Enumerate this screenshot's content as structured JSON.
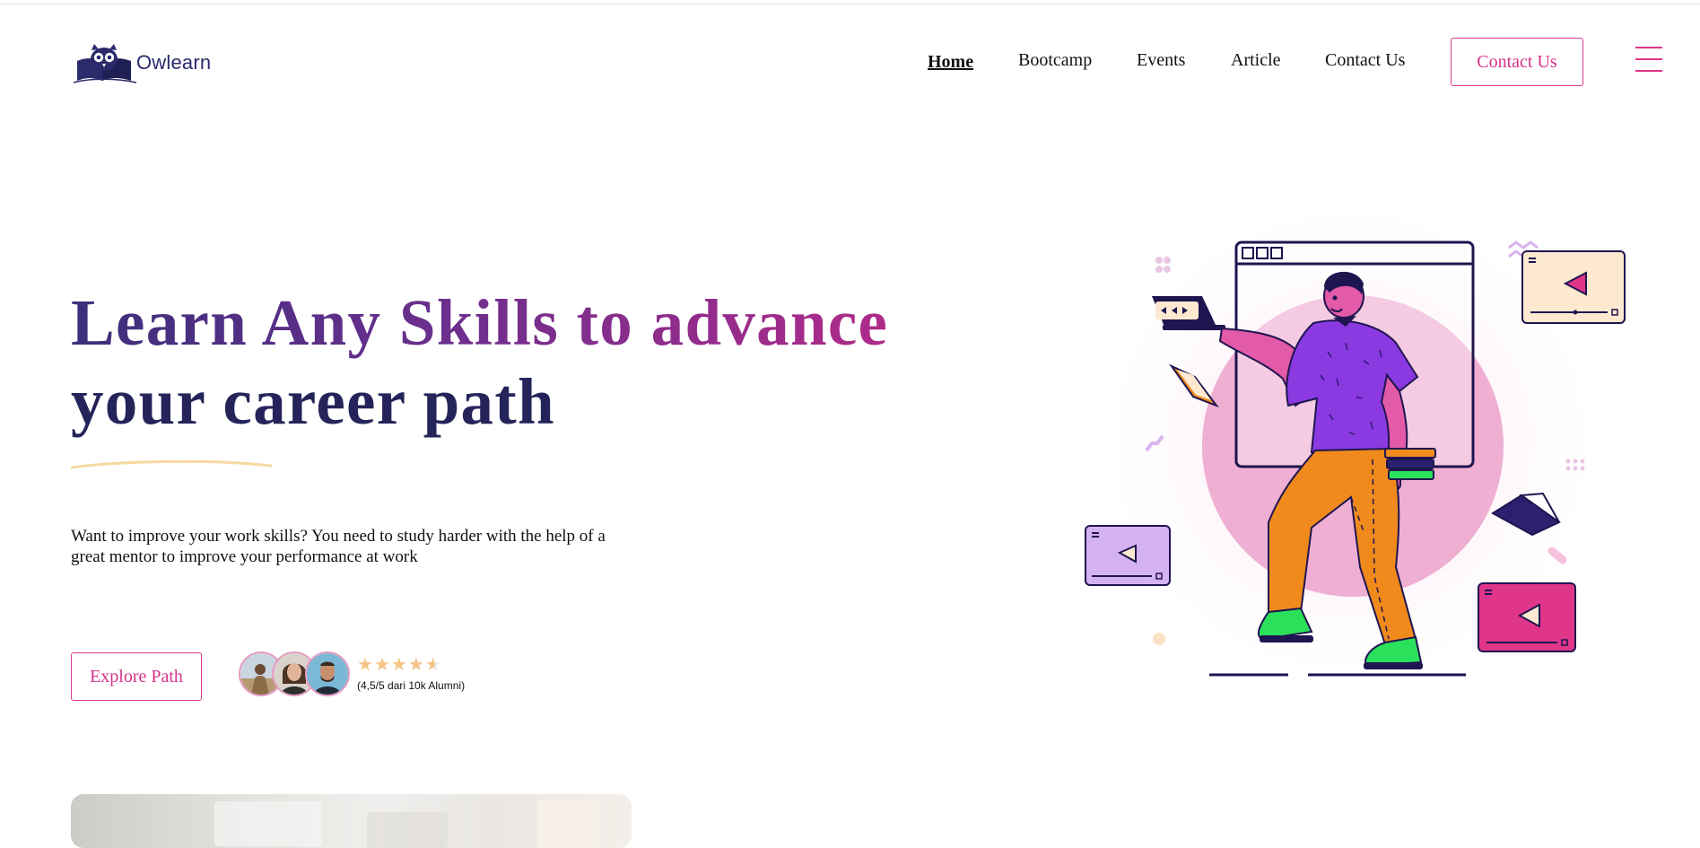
{
  "brand": {
    "name": "Owlearn"
  },
  "nav": {
    "items": [
      {
        "label": "Home",
        "active": true
      },
      {
        "label": "Bootcamp",
        "active": false
      },
      {
        "label": "Events",
        "active": false
      },
      {
        "label": "Article",
        "active": false
      },
      {
        "label": "Contact Us",
        "active": false
      }
    ],
    "cta_label": "Contact Us",
    "menu_icon": "hamburger-menu-icon"
  },
  "hero": {
    "title_line1": "Learn Any Skills to advance",
    "title_line2": "your career path",
    "description": "Want to improve your work skills? You need to study harder with the help of a great mentor to improve your performance at work",
    "explore_label": "Explore Path",
    "rating": {
      "score": 4.5,
      "max": 5,
      "text": "(4,5/5 dari 10k Alumni)"
    },
    "alumni_avatars": 3
  },
  "colors": {
    "accent_pink": "#d6338a",
    "title_navy": "#25245a",
    "title_gradient_start": "#3c2f7a",
    "title_gradient_end": "#b02b8a",
    "underline_gold": "#f6d9a0",
    "star": "#f4c485"
  }
}
